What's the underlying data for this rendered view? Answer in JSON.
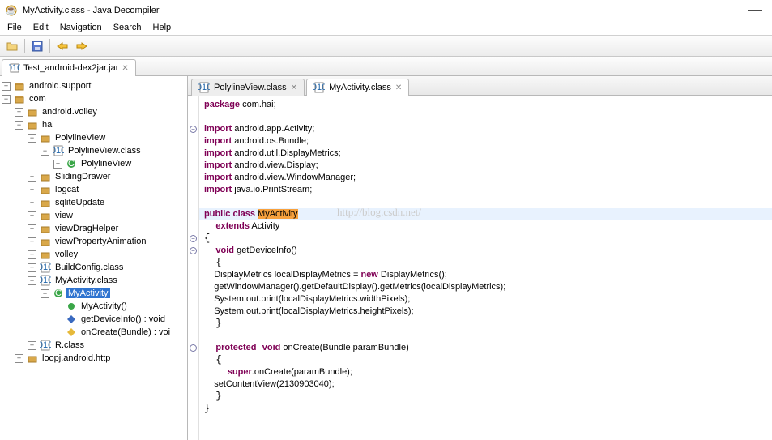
{
  "window": {
    "title": "MyActivity.class - Java Decompiler"
  },
  "menu": {
    "file": "File",
    "edit": "Edit",
    "nav": "Navigation",
    "search": "Search",
    "help": "Help"
  },
  "maintab": {
    "label": "Test_android-dex2jar.jar"
  },
  "tree": {
    "n0": "android.support",
    "n1": "com",
    "n2": "android.volley",
    "n3": "hai",
    "n4": "PolylineView",
    "n5": "PolylineView.class",
    "n6": "PolylineView",
    "n7": "SlidingDrawer",
    "n8": "logcat",
    "n9": "sqliteUpdate",
    "n10": "view",
    "n11": "viewDragHelper",
    "n12": "viewPropertyAnimation",
    "n13": "volley",
    "n14": "BuildConfig.class",
    "n15": "MyActivity.class",
    "n16": "MyActivity",
    "n17": "MyActivity()",
    "n18": "getDeviceInfo() : void",
    "n19": "onCreate(Bundle) : voi",
    "n20": "R.class",
    "n21": "loopj.android.http"
  },
  "editorTabs": {
    "t0": "PolylineView.class",
    "t1": "MyActivity.class"
  },
  "code": {
    "pkg_kw": "package",
    "pkg": " com.hai;",
    "imp_kw": "import",
    "imp1": " android.app.Activity;",
    "imp2": " android.os.Bundle;",
    "imp3": " android.util.DisplayMetrics;",
    "imp4": " android.view.Display;",
    "imp5": " android.view.WindowManager;",
    "imp6": " java.io.PrintStream;",
    "pub": "public",
    "cls": "class",
    "clsname": "MyActivity",
    "ext": "extends",
    "extname": " Activity",
    "vd": "void",
    "m1": " getDeviceInfo()",
    "l1": "    DisplayMetrics localDisplayMetrics = ",
    "nw": "new",
    "l1b": " DisplayMetrics();",
    "l2": "    getWindowManager().getDefaultDisplay().getMetrics(localDisplayMetrics);",
    "l3": "    System.out.print(localDisplayMetrics.widthPixels);",
    "l4": "    System.out.print(localDisplayMetrics.heightPixels);",
    "prot": "protected",
    "m2": " onCreate(Bundle paramBundle)",
    "sup": "super",
    "l5": ".onCreate(paramBundle);",
    "l6": "    setContentView(2130903040);",
    "wm": "http://blog.csdn.net/"
  }
}
